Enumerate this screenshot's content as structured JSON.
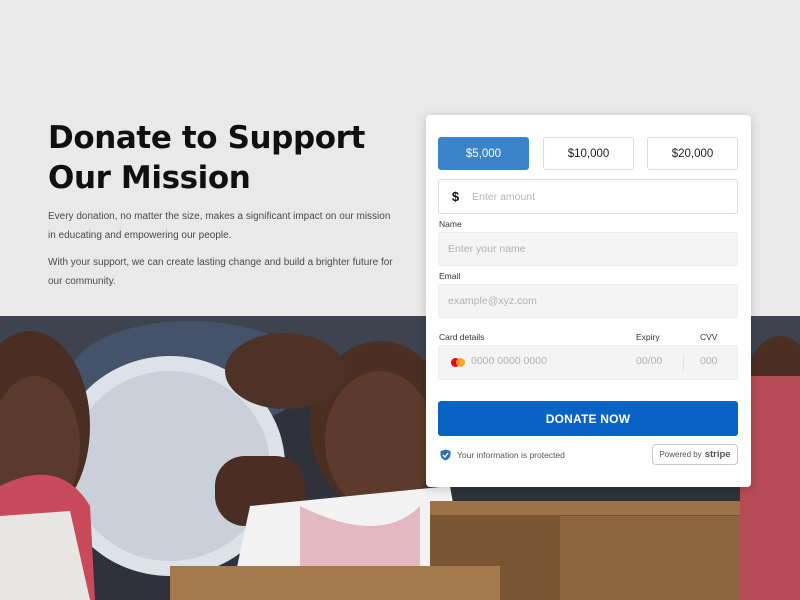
{
  "hero": {
    "title": "Donate to Support Our Mission",
    "paragraph_1": "Every donation, no matter the size, makes a significant impact on our mission in educating and empowering our people.",
    "paragraph_2": "With your support, we can create lasting change and build a brighter future for our community."
  },
  "donation_form": {
    "amount_options": [
      "$5,000",
      "$10,000",
      "$20,000"
    ],
    "selected_amount": "$5,000",
    "currency_symbol": "$",
    "amount_placeholder": "Enter amount",
    "name_label": "Name",
    "name_placeholder": "Enter your name",
    "email_label": "Email",
    "email_placeholder": "example@xyz.com",
    "card_label": "Card details",
    "expiry_label": "Expiry",
    "cvv_label": "CVV",
    "card_placeholder": "0000 0000 0000",
    "expiry_placeholder": "00/00",
    "cvv_placeholder": "000",
    "card_brand_icon": "mastercard-icon",
    "submit_label": "DONATE NOW",
    "security_note": "Your information is protected",
    "powered_by": "Powered by",
    "powered_by_brand": "stripe"
  },
  "colors": {
    "accent": "#3b84c9",
    "button": "#0a63c4",
    "background": "#e9e9e9"
  }
}
